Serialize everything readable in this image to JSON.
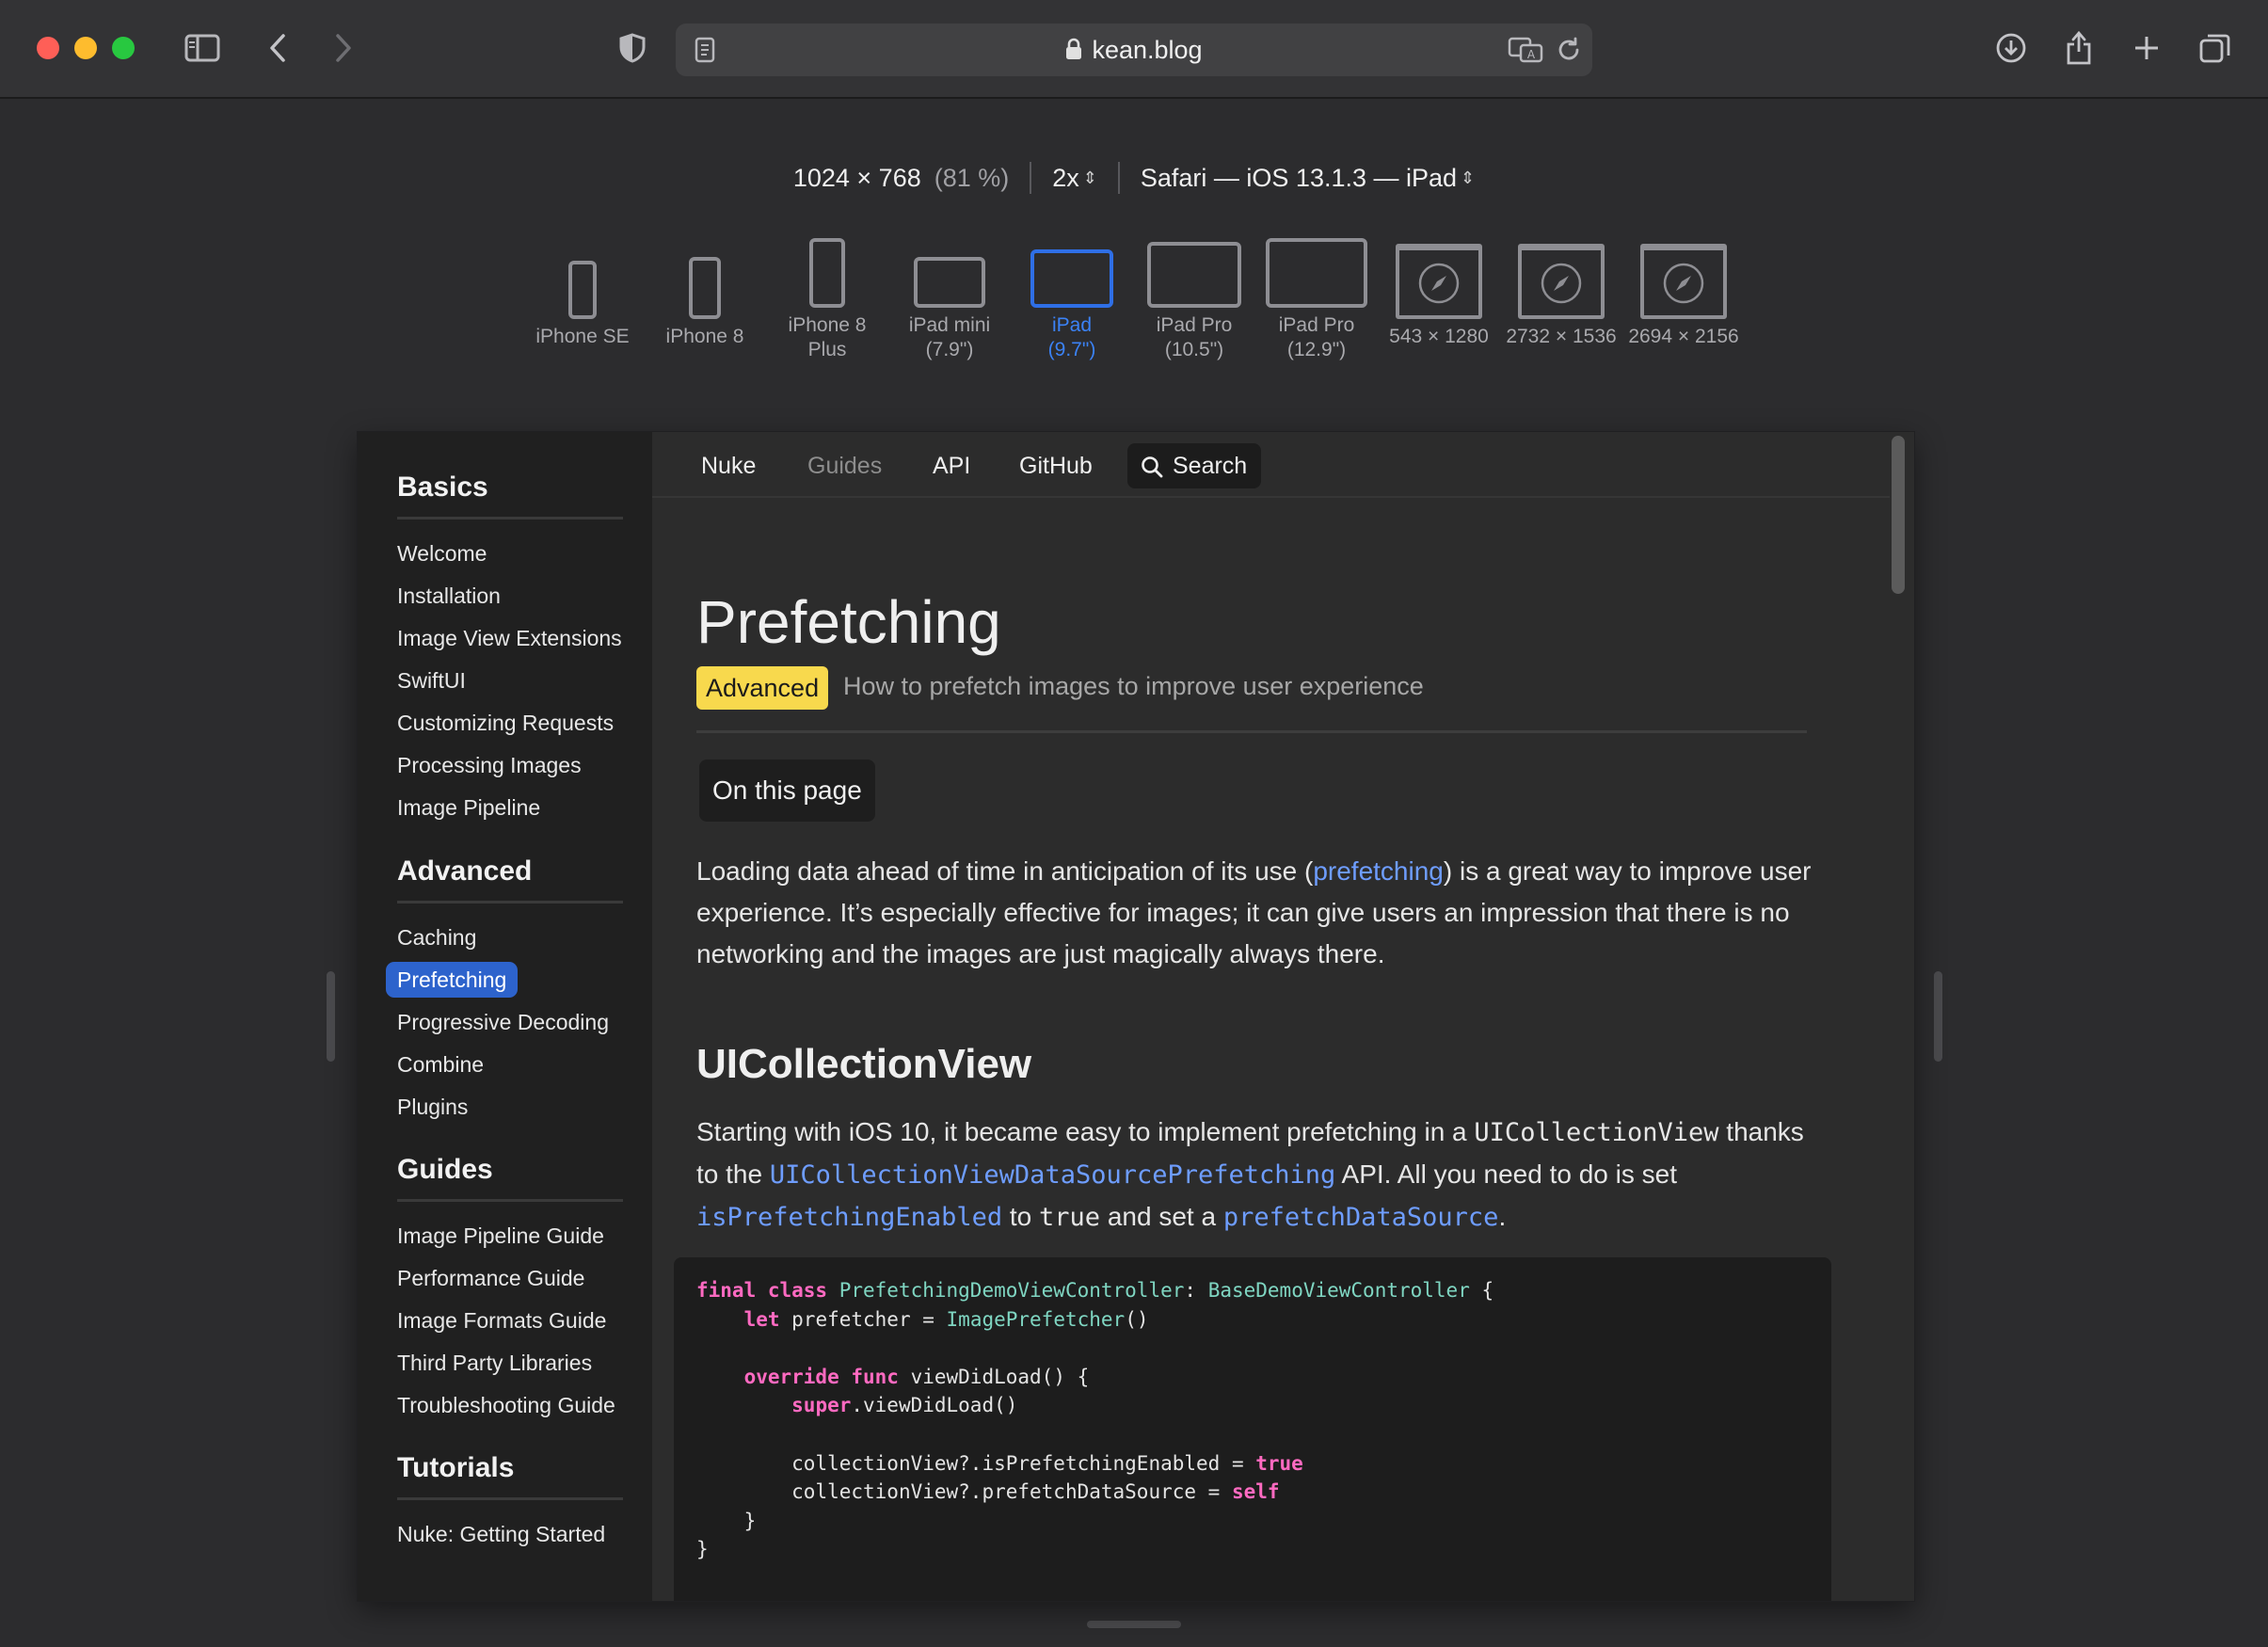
{
  "browser": {
    "url": "kean.blog"
  },
  "responsive": {
    "resolution": "1024 × 768",
    "zoom": "(81 %)",
    "pixel_ratio": "2x",
    "user_agent": "Safari — iOS 13.1.3 — iPad",
    "devices": [
      {
        "label": "iPhone SE"
      },
      {
        "label": "iPhone 8"
      },
      {
        "label": "iPhone 8\nPlus"
      },
      {
        "label": "iPad mini\n(7.9\")"
      },
      {
        "label": "iPad\n(9.7\")",
        "active": true
      },
      {
        "label": "iPad Pro\n(10.5\")"
      },
      {
        "label": "iPad Pro\n(12.9\")"
      },
      {
        "label": "543 × 1280"
      },
      {
        "label": "2732 × 1536"
      },
      {
        "label": "2694 × 2156"
      }
    ]
  },
  "sidebar": {
    "basics": {
      "title": "Basics",
      "items": [
        "Welcome",
        "Installation",
        "Image View Extensions",
        "SwiftUI",
        "Customizing Requests",
        "Processing Images",
        "Image Pipeline"
      ]
    },
    "advanced": {
      "title": "Advanced",
      "items": [
        "Caching",
        "Prefetching",
        "Progressive Decoding",
        "Combine",
        "Plugins"
      ],
      "active": "Prefetching"
    },
    "guides": {
      "title": "Guides",
      "items": [
        "Image Pipeline Guide",
        "Performance Guide",
        "Image Formats Guide",
        "Third Party Libraries",
        "Troubleshooting Guide"
      ]
    },
    "tutorials": {
      "title": "Tutorials",
      "items": [
        "Nuke: Getting Started"
      ]
    }
  },
  "nav": {
    "nuke": "Nuke",
    "guides": "Guides",
    "api": "API",
    "github": "GitHub",
    "search": "Search"
  },
  "article": {
    "title": "Prefetching",
    "badge": "Advanced",
    "subtitle": "How to prefetch images to improve user experience",
    "on_this_page": "On this page",
    "intro": {
      "before": "Loading data ahead of time in anticipation of its use (",
      "link": "prefetching",
      "after": ") is a great way to improve user experience. It’s especially effective for images; it can give users an impression that there is no networking and the images are just magically always there."
    },
    "h2": "UICollectionView",
    "p2": {
      "t1": "Starting with iOS 10, it became easy to implement prefetching in a ",
      "c1": "UICollectionView",
      "t2": " thanks to the ",
      "c2": "UICollectionViewDataSourcePrefetching",
      "t3": " API. All you need to do is set ",
      "c3": "isPrefetchingEnabled",
      "t4": " to ",
      "c4": "true",
      "t5": " and set a ",
      "c5": "prefetchDataSource",
      "t6": "."
    },
    "code": {
      "l1_kw": "final class",
      "l1_ty": "PrefetchingDemoViewController",
      "l1_colon": ": ",
      "l1_ty2": "BaseDemoViewController",
      "l1_end": " {",
      "l2_kw": "let",
      "l2_mid": " prefetcher = ",
      "l2_ty": "ImagePrefetcher",
      "l2_end": "()",
      "l4_kw": "override func",
      "l4_end": " viewDidLoad() {",
      "l5_kw": "super",
      "l5_end": ".viewDidLoad()",
      "l7_a": "collectionView?.isPrefetchingEnabled = ",
      "l7_kw": "true",
      "l8_a": "collectionView?.prefetchDataSource = ",
      "l8_kw": "self",
      "l9": "}",
      "l10": "}"
    }
  },
  "colors": {
    "accent": "#2f6fe6",
    "badge": "#f8d94d",
    "link": "#6e9dff"
  }
}
